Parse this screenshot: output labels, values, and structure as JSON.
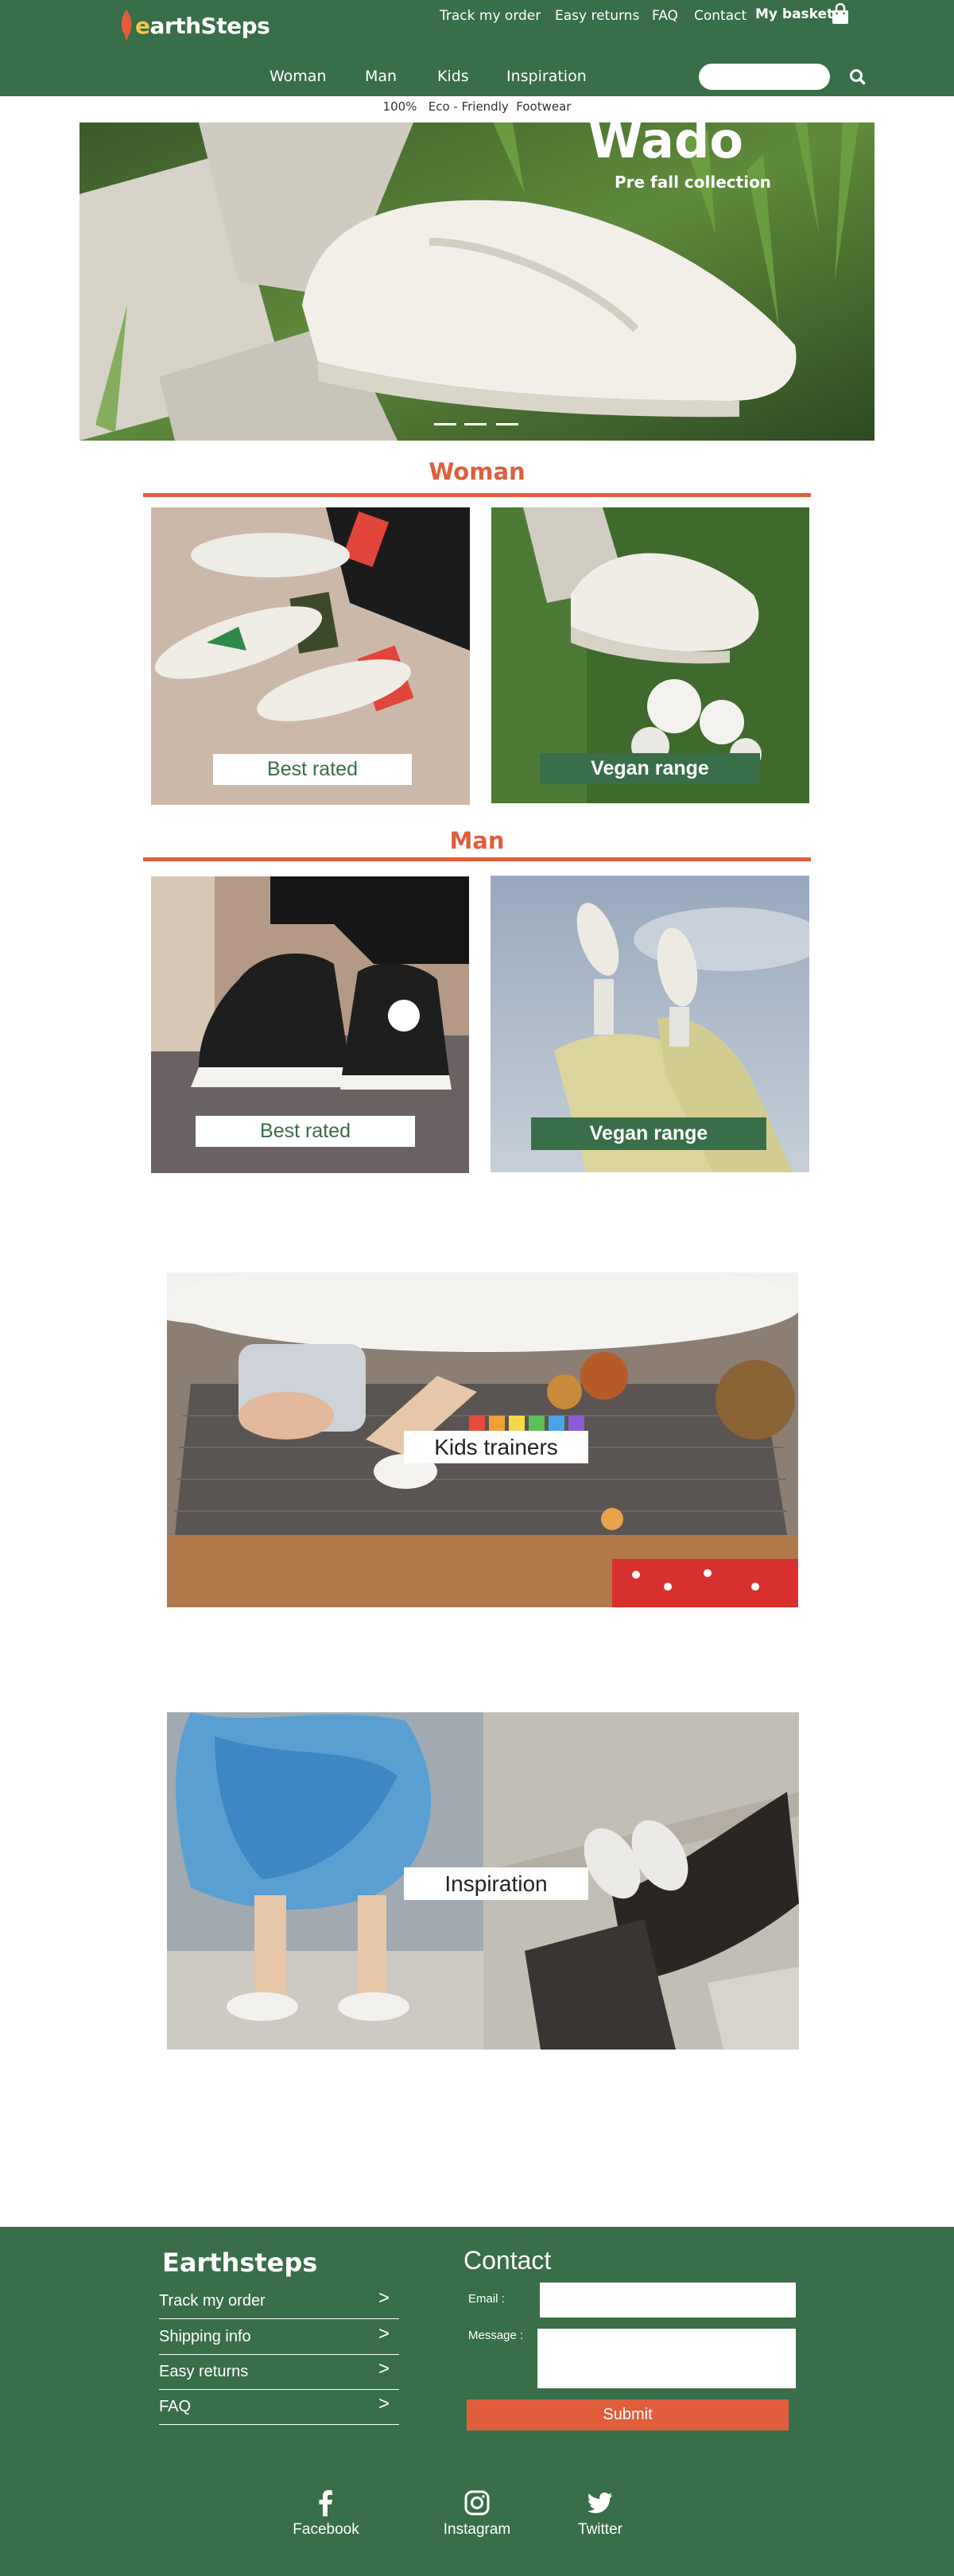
{
  "header": {
    "brand_prefix": "e",
    "brand_rest": "arthSteps",
    "top_links": [
      "Track my order",
      "Easy returns",
      "FAQ",
      "Contact"
    ],
    "basket_label": "My basket",
    "nav": [
      "Woman",
      "Man",
      "Kids",
      "Inspiration"
    ],
    "search_placeholder": ""
  },
  "tagline": "100%   Eco - Friendly  Footwear",
  "hero": {
    "title": "Wado",
    "subtitle": "Pre fall collection"
  },
  "woman": {
    "title": "Woman",
    "best_rated": "Best rated",
    "vegan_range": "Vegan range"
  },
  "man": {
    "title": "Man",
    "best_rated": "Best rated",
    "vegan_range": "Vegan range"
  },
  "kids": {
    "label": "Kids trainers"
  },
  "inspiration": {
    "label": "Inspiration"
  },
  "footer": {
    "brand": "Earthsteps",
    "links": [
      "Track my order",
      "Shipping info",
      "Easy returns",
      "FAQ"
    ],
    "chevron": ">",
    "contact_title": "Contact",
    "email_label": "Email :",
    "message_label": "Message :",
    "submit_label": "Submit",
    "social": [
      "Facebook",
      "Instagram",
      "Twitter"
    ]
  },
  "colors": {
    "brand_green": "#386e48",
    "accent_orange": "#e05e3c",
    "logo_yellow": "#f4c64b"
  }
}
